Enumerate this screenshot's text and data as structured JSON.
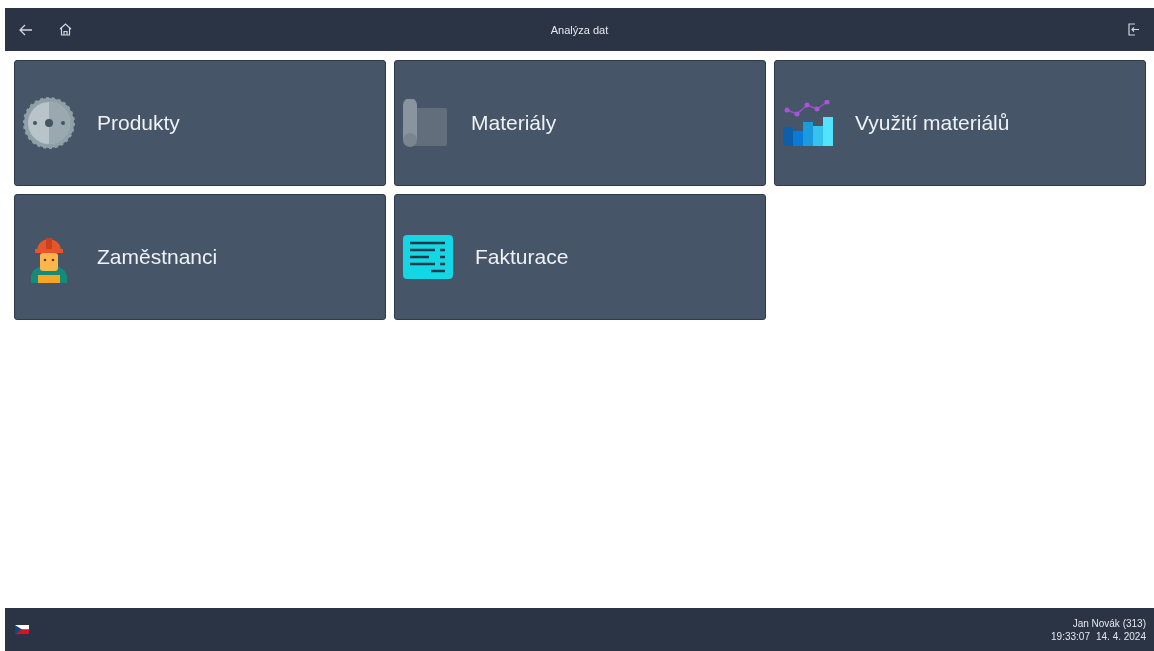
{
  "header": {
    "title": "Analýza dat"
  },
  "tiles": [
    {
      "label": "Produkty",
      "kind": "saw"
    },
    {
      "label": "Materiály",
      "kind": "roll"
    },
    {
      "label": "Využití materiálů",
      "kind": "chart"
    },
    {
      "label": "Zaměstnanci",
      "kind": "worker"
    },
    {
      "label": "Fakturace",
      "kind": "invoice"
    }
  ],
  "footer": {
    "user": "Jan Novák (313)",
    "time": "19:33:07",
    "date": "14. 4. 2024"
  }
}
